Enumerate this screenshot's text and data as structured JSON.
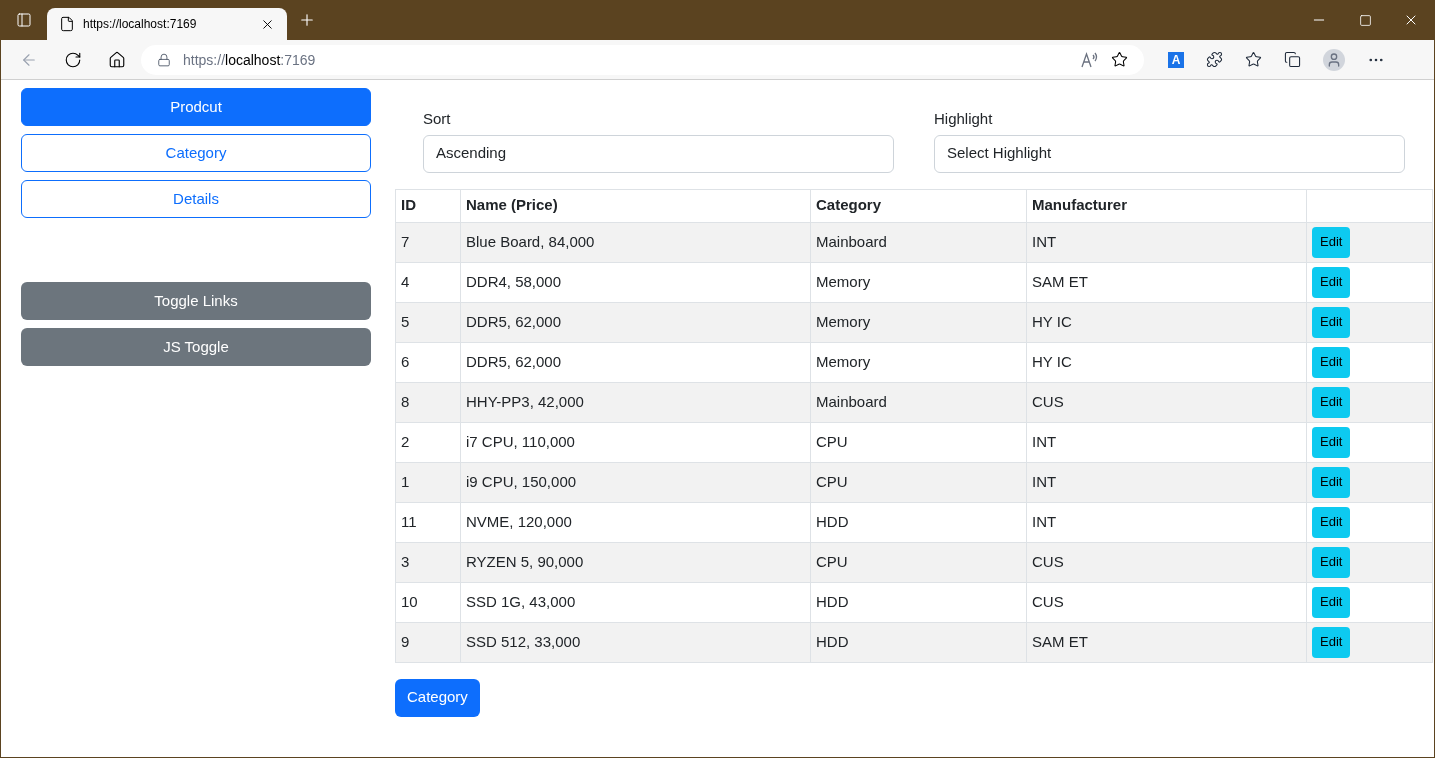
{
  "browser": {
    "tab_title": "https://localhost:7169",
    "url_prefix": "https://",
    "url_host": "localhost",
    "url_suffix": ":7169",
    "translate_label": "A"
  },
  "nav": [
    {
      "label": "Prodcut",
      "selected": true
    },
    {
      "label": "Category",
      "selected": false
    },
    {
      "label": "Details",
      "selected": false
    }
  ],
  "toggles": [
    "Toggle Links",
    "JS Toggle"
  ],
  "filters": [
    {
      "label": "Sort",
      "value": "Ascending"
    },
    {
      "label": "Highlight",
      "value": "Select Highlight"
    }
  ],
  "table": {
    "columns": [
      "ID",
      "Name (Price)",
      "Category",
      "Manufacturer"
    ],
    "rows": [
      {
        "cells": [
          "7",
          "Blue Board, 84,000",
          "Mainboard",
          "INT"
        ],
        "action": "Edit"
      },
      {
        "cells": [
          "4",
          "DDR4, 58,000",
          "Memory",
          "SAM ET"
        ],
        "action": "Edit"
      },
      {
        "cells": [
          "5",
          "DDR5, 62,000",
          "Memory",
          "HY IC"
        ],
        "action": "Edit"
      },
      {
        "cells": [
          "6",
          "DDR5, 62,000",
          "Memory",
          "HY IC"
        ],
        "action": "Edit"
      },
      {
        "cells": [
          "8",
          "HHY-PP3, 42,000",
          "Mainboard",
          "CUS"
        ],
        "action": "Edit"
      },
      {
        "cells": [
          "2",
          "i7 CPU, 110,000",
          "CPU",
          "INT"
        ],
        "action": "Edit"
      },
      {
        "cells": [
          "1",
          "i9 CPU, 150,000",
          "CPU",
          "INT"
        ],
        "action": "Edit"
      },
      {
        "cells": [
          "11",
          "NVME, 120,000",
          "HDD",
          "INT"
        ],
        "action": "Edit"
      },
      {
        "cells": [
          "3",
          "RYZEN 5, 90,000",
          "CPU",
          "CUS"
        ],
        "action": "Edit"
      },
      {
        "cells": [
          "10",
          "SSD 1G, 43,000",
          "HDD",
          "CUS"
        ],
        "action": "Edit"
      },
      {
        "cells": [
          "9",
          "SSD 512, 33,000",
          "HDD",
          "SAM ET"
        ],
        "action": "Edit"
      }
    ]
  },
  "footer_button": "Category"
}
